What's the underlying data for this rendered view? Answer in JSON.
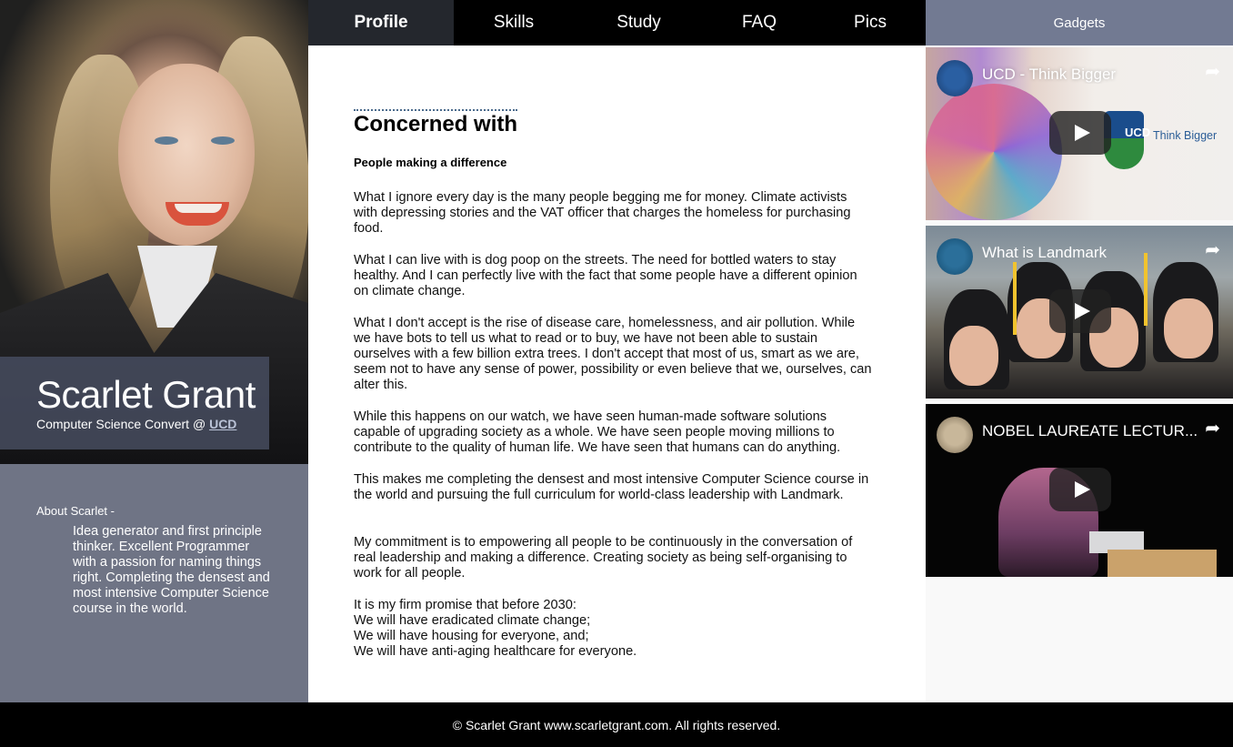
{
  "nav": {
    "items": [
      {
        "label": "Profile",
        "active": true
      },
      {
        "label": "Skills",
        "active": false
      },
      {
        "label": "Study",
        "active": false
      },
      {
        "label": "FAQ",
        "active": false
      },
      {
        "label": "Pics",
        "active": false
      }
    ]
  },
  "sidebar": {
    "name": "Scarlet Grant",
    "subtitle_prefix": "Computer Science Convert @ ",
    "subtitle_link": "UCD",
    "about_title": "About Scarlet -",
    "about_text": "Idea generator and first principle thinker. Excellent Programmer with a passion for naming things right. Completing the densest and most intensive Computer Science course in the world."
  },
  "main": {
    "title": "Concerned with",
    "subtitle": "People making a difference",
    "paragraphs": [
      "What I ignore every day is the many people begging me for money. Climate activists with depressing stories and the VAT officer that charges the homeless for purchasing food.",
      "What I can live with is dog poop on the streets. The need for bottled waters to stay healthy. And I can perfectly live with the fact that some people have a different opinion on climate change.",
      "What I don't accept is the rise of disease care, homelessness, and air pollution. While we have bots to tell us what to read or to buy, we have not been able to sustain ourselves with a few billion extra trees. I don't accept that most of us, smart as we are, seem not to have any sense of power, possibility or even believe that we, ourselves, can alter this.",
      "While this happens on our watch, we have seen human-made software solutions capable of upgrading society as a whole. We have seen people moving millions to contribute to the quality of human life. We have seen that humans can do anything.",
      "This makes me completing the densest and most intensive Computer Science course in the world and pursuing the full curriculum for world-class leadership with Landmark.",
      "My commitment is to empowering all people to be continuously in the conversation of real leadership and making a difference. Creating society as being self-organising to work for all people."
    ],
    "promise": [
      "It is my firm promise that before 2030:",
      "We will have eradicated climate change;",
      "We will have housing for everyone, and;",
      "We will have anti-aging healthcare for everyone."
    ]
  },
  "gadgets": {
    "title": "Gadgets",
    "videos": [
      {
        "title": "UCD - Think Bigger",
        "logo_text": "UCD",
        "overlay_text": "Think Bigger"
      },
      {
        "title": "What is Landmark"
      },
      {
        "title": "NOBEL LAUREATE LECTUR..."
      }
    ]
  },
  "footer": {
    "text": "© Scarlet Grant www.scarletgrant.com. All rights reserved."
  },
  "colors": {
    "sidebar_bg": "#6f7485",
    "gadgets_header": "#727a92",
    "nav_bg": "#000000",
    "nav_active": "#24272d"
  },
  "icons": [
    "share-icon",
    "play-icon",
    "channel-avatar-icon"
  ]
}
